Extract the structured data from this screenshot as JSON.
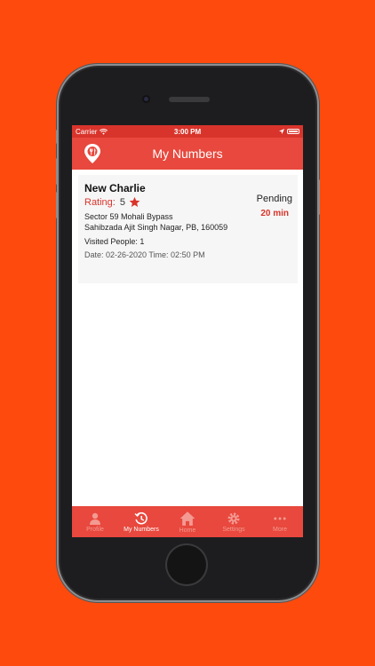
{
  "statusbar": {
    "carrier": "Carrier",
    "time": "3:00 PM"
  },
  "navbar": {
    "title": "My Numbers"
  },
  "card": {
    "name": "New Charlie",
    "rating_label": "Rating:",
    "rating_value": "5",
    "address_line1": "Sector 59 Mohali Bypass",
    "address_line2": "Sahibzada Ajit Singh Nagar, PB, 160059",
    "visited": "Visited People: 1",
    "datetime": "Date: 02-26-2020 Time: 02:50 PM",
    "status": "Pending",
    "eta": "20 min"
  },
  "tabs": [
    {
      "label": "Profile",
      "icon": "person-icon",
      "active": false
    },
    {
      "label": "My Numbers",
      "icon": "history-icon",
      "active": true
    },
    {
      "label": "Home",
      "icon": "home-icon",
      "active": false
    },
    {
      "label": "Settings",
      "icon": "gear-icon",
      "active": false
    },
    {
      "label": "More",
      "icon": "more-dots-icon",
      "active": false
    }
  ],
  "colors": {
    "brand": "#e8483d",
    "statusbar": "#d9342b",
    "background": "#ff4a0d"
  }
}
